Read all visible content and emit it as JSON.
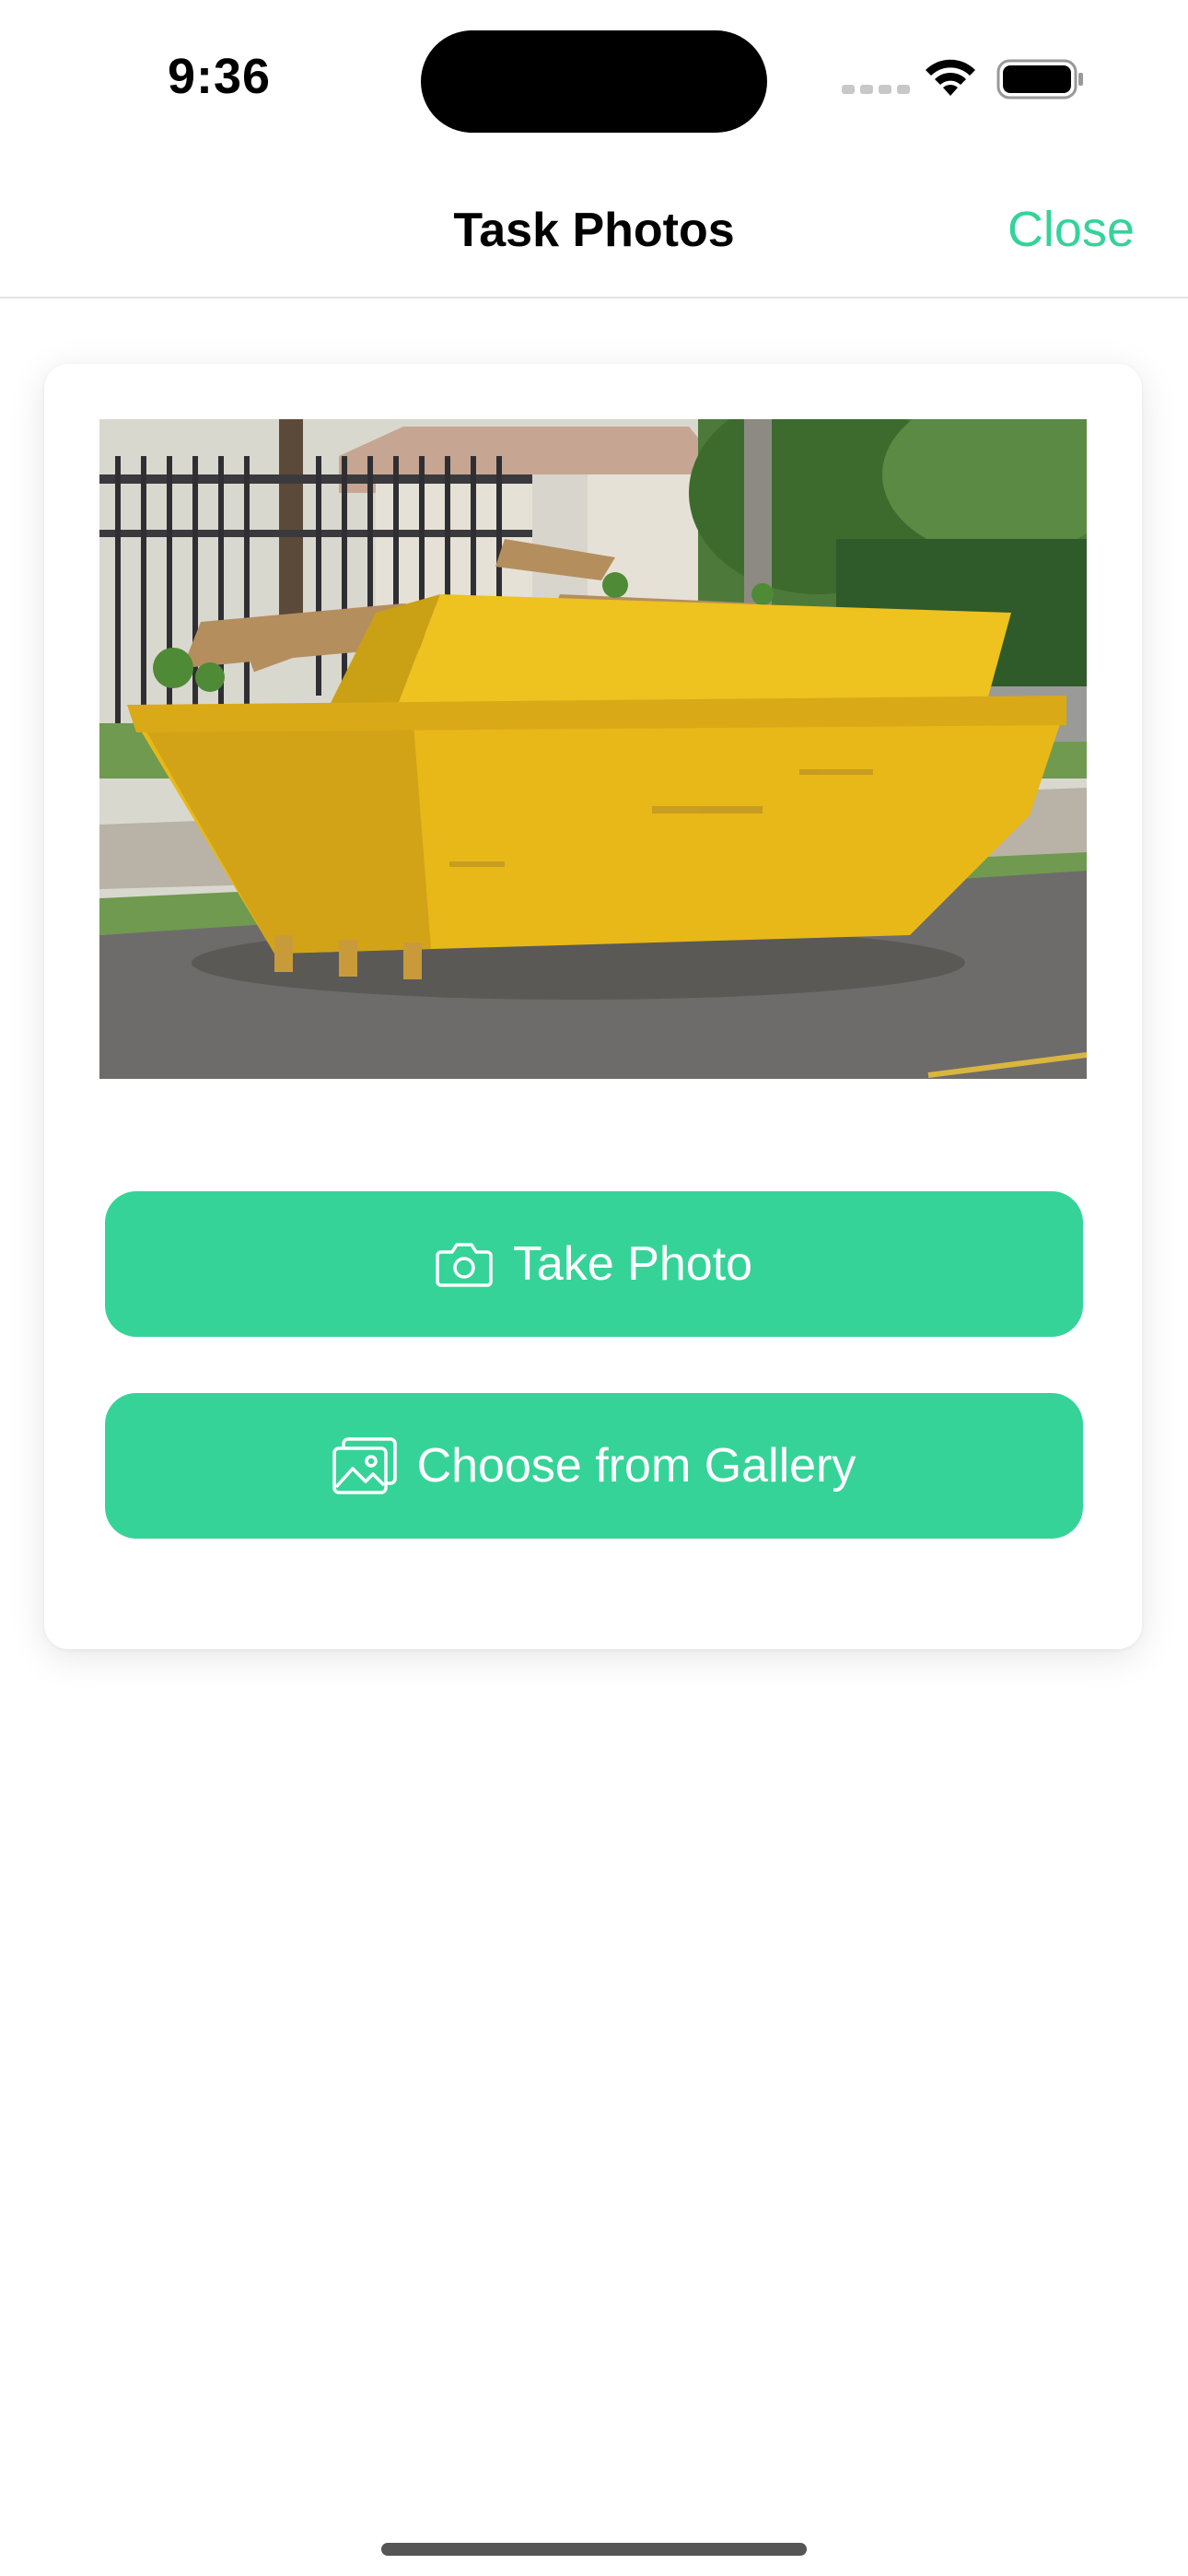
{
  "status_bar": {
    "time": "9:36",
    "wifi_icon": "wifi-icon",
    "battery_icon": "battery-icon",
    "signal_icon": "cellular-signal-icon"
  },
  "nav": {
    "title": "Task Photos",
    "close_label": "Close"
  },
  "photo": {
    "alt_subject": "yellow skip dumpster with wooden debris"
  },
  "buttons": {
    "take_photo": {
      "label": "Take Photo",
      "icon": "camera-icon"
    },
    "gallery": {
      "label": "Choose from Gallery",
      "icon": "gallery-icon"
    }
  },
  "colors": {
    "accent": "#36d399",
    "close_text": "#34d399",
    "background": "#ffffff"
  }
}
